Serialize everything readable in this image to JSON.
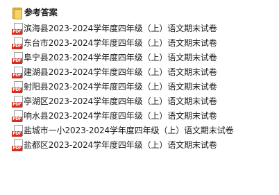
{
  "folder": {
    "icon": "folder-icon",
    "name": "参考答案"
  },
  "files": [
    {
      "icon": "pdf-icon",
      "type_tag": "PDF",
      "name": "滨海县2023-2024学年度四年级（上）语文期末试卷"
    },
    {
      "icon": "pdf-icon",
      "type_tag": "PDF",
      "name": "东台市2023-2024学年度四年级（上）语文期末试卷"
    },
    {
      "icon": "pdf-icon",
      "type_tag": "PDF",
      "name": "阜宁县2023-2024学年度四年级（上）语文期末试卷"
    },
    {
      "icon": "pdf-icon",
      "type_tag": "PDF",
      "name": "建湖县2023-2024学年度四年级（上）语文期末试卷"
    },
    {
      "icon": "pdf-icon",
      "type_tag": "PDF",
      "name": "射阳县2023-2024学年度四年级（上）语文期末试卷"
    },
    {
      "icon": "pdf-icon",
      "type_tag": "PDF",
      "name": "亭湖区2023-2024学年度四年级（上）语文期末试卷"
    },
    {
      "icon": "pdf-icon",
      "type_tag": "PDF",
      "name": "响水县2023-2024学年度四年级（上）语文期末试卷"
    },
    {
      "icon": "pdf-icon",
      "type_tag": "PDF",
      "name": "盐城市一小2023-2024学年度四年级（上）语文期末试卷"
    },
    {
      "icon": "pdf-icon",
      "type_tag": "PDF",
      "name": "盐都区2023-2024学年度四年级（上）语文期末试卷"
    }
  ],
  "colors": {
    "pdf_badge": "#d32f1f",
    "folder": "#f7d46a",
    "text": "#1a1a1a"
  }
}
